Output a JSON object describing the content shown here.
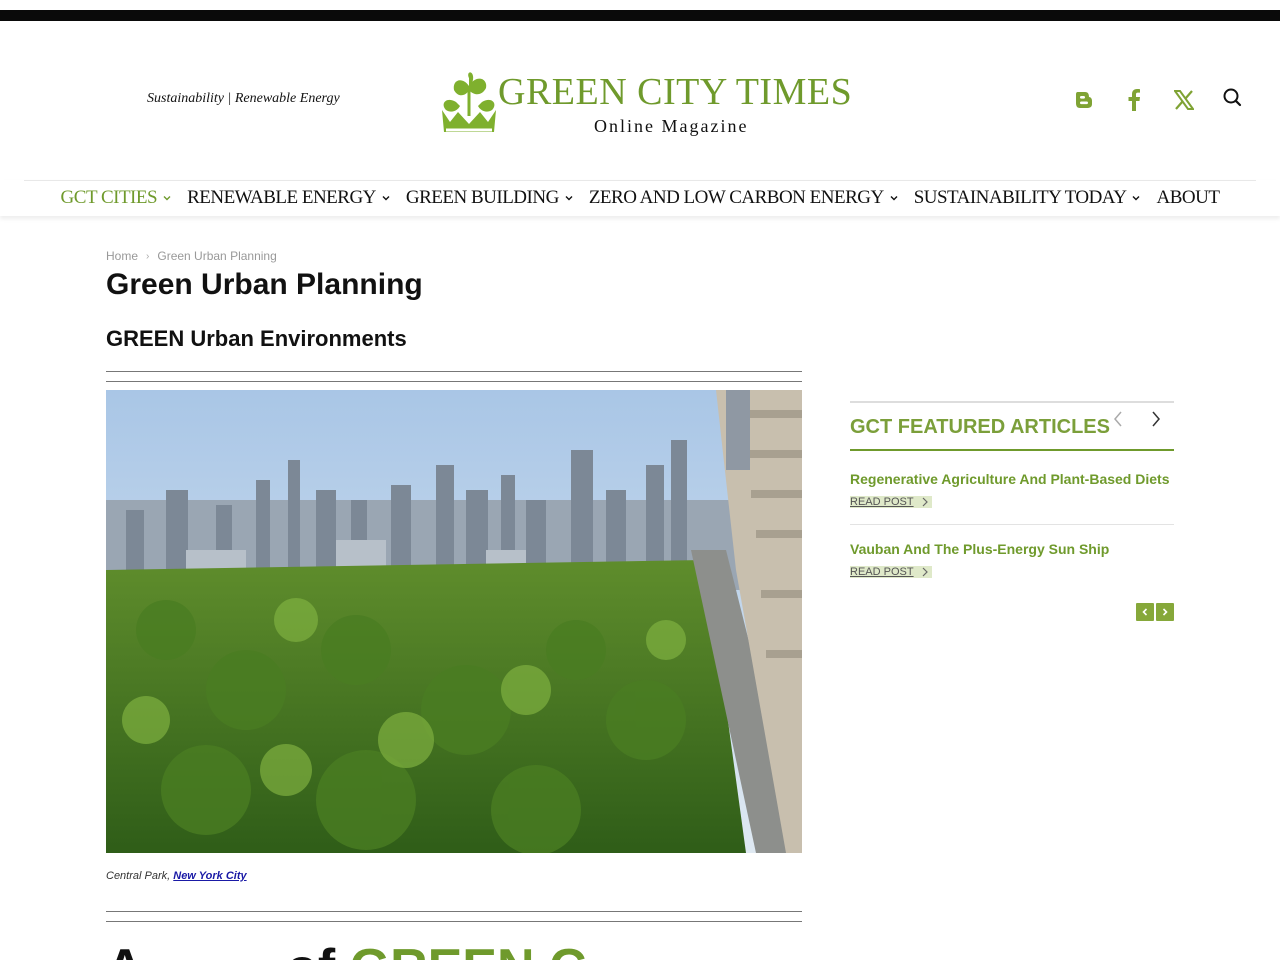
{
  "header": {
    "tagline": "Sustainability | Renewable Energy",
    "logo_title": "GREEN CITY TIMES",
    "logo_subtitle": "Online Magazine"
  },
  "social": {
    "icons": [
      "blogger-icon",
      "facebook-icon",
      "x-twitter-icon"
    ],
    "search_icon": "search-icon"
  },
  "nav": {
    "items": [
      {
        "label": "GCT CITIES",
        "active": true,
        "has_dropdown": true
      },
      {
        "label": "RENEWABLE ENERGY",
        "active": false,
        "has_dropdown": true
      },
      {
        "label": "GREEN BUILDING",
        "active": false,
        "has_dropdown": true
      },
      {
        "label": "ZERO AND LOW CARBON ENERGY",
        "active": false,
        "has_dropdown": true
      },
      {
        "label": "SUSTAINABILITY TODAY",
        "active": false,
        "has_dropdown": true
      },
      {
        "label": "ABOUT",
        "active": false,
        "has_dropdown": false
      }
    ]
  },
  "breadcrumb": {
    "home": "Home",
    "separator": "›",
    "current": "Green Urban Planning"
  },
  "page": {
    "title": "Green Urban Planning",
    "subtitle": "GREEN Urban Environments",
    "caption_prefix": "Central Park, ",
    "caption_link": "New York City",
    "bottom_heading_dark": "A",
    "bottom_heading_mid": "          of ",
    "bottom_heading_green": "GREEN C"
  },
  "sidebar": {
    "title": "GCT FEATURED ARTICLES",
    "articles": [
      {
        "title": "Regenerative Agriculture And Plant-Based Diets",
        "link": "READ POST"
      },
      {
        "title": "Vauban And The Plus-Energy Sun Ship",
        "link": "READ POST"
      }
    ]
  },
  "colors": {
    "brand_green": "#6f9a2c",
    "sidebar_green": "#7b9f3a",
    "pager_green": "#86a83a"
  }
}
